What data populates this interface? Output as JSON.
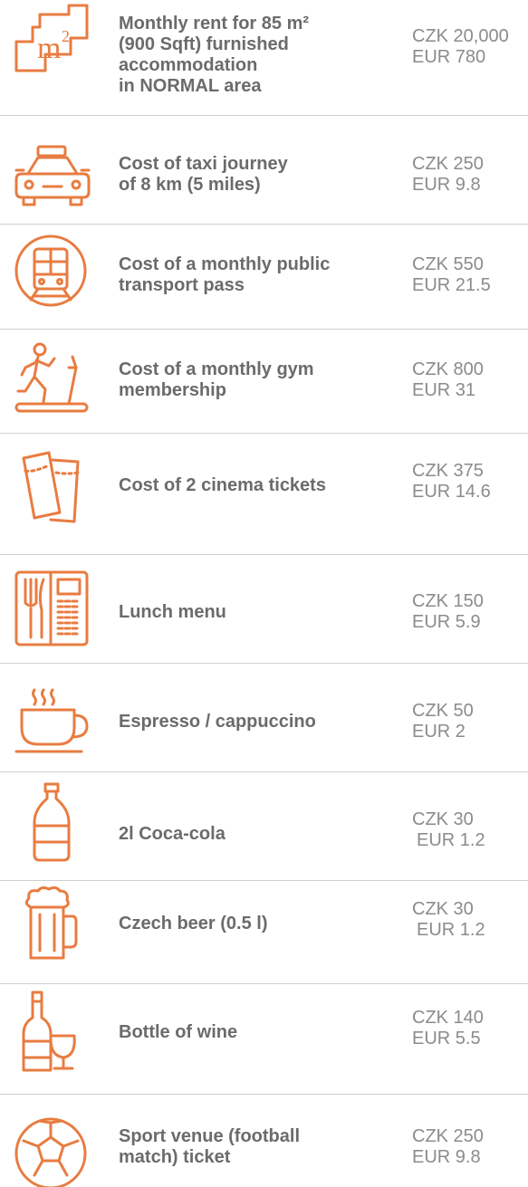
{
  "accent_color": "#e87c41",
  "items": [
    {
      "icon": "square-meter-icon",
      "label_lines": [
        "Monthly rent for 85 m²",
        "(900 Sqft) furnished",
        "accommodation",
        "in NORMAL area"
      ],
      "czk": "CZK 20,000",
      "eur": "EUR 780"
    },
    {
      "icon": "taxi-icon",
      "label_lines": [
        "Cost of taxi journey",
        "of 8 km (5 miles)"
      ],
      "czk": "CZK 250",
      "eur": "EUR 9.8"
    },
    {
      "icon": "tram-icon",
      "label_lines": [
        "Cost of a monthly public",
        "transport pass"
      ],
      "czk": "CZK 550",
      "eur": "EUR 21.5"
    },
    {
      "icon": "treadmill-runner-icon",
      "label_lines": [
        "Cost of a monthly gym",
        "membership"
      ],
      "czk": "CZK 800",
      "eur": "EUR 31"
    },
    {
      "icon": "cinema-tickets-icon",
      "label_lines": [
        "Cost of 2 cinema tickets"
      ],
      "czk": "CZK 375",
      "eur": "EUR 14.6"
    },
    {
      "icon": "menu-fork-knife-icon",
      "label_lines": [
        "Lunch menu"
      ],
      "czk": "CZK 150",
      "eur": "EUR 5.9"
    },
    {
      "icon": "coffee-cup-icon",
      "label_lines": [
        "Espresso / cappuccino"
      ],
      "czk": "CZK 50",
      "eur": "EUR 2"
    },
    {
      "icon": "soda-bottle-icon",
      "label_lines": [
        "2l Coca-cola"
      ],
      "czk": "CZK 30",
      "eur": "EUR 1.2"
    },
    {
      "icon": "beer-mug-icon",
      "label_lines": [
        "Czech beer (0.5 l)"
      ],
      "czk": "CZK 30",
      "eur": "EUR 1.2"
    },
    {
      "icon": "wine-bottle-glass-icon",
      "label_lines": [
        "Bottle of wine"
      ],
      "czk": "CZK 140",
      "eur": "EUR 5.5"
    },
    {
      "icon": "football-icon",
      "label_lines": [
        "Sport venue (football",
        "match) ticket"
      ],
      "czk": "CZK 250",
      "eur": "EUR 9.8"
    }
  ]
}
